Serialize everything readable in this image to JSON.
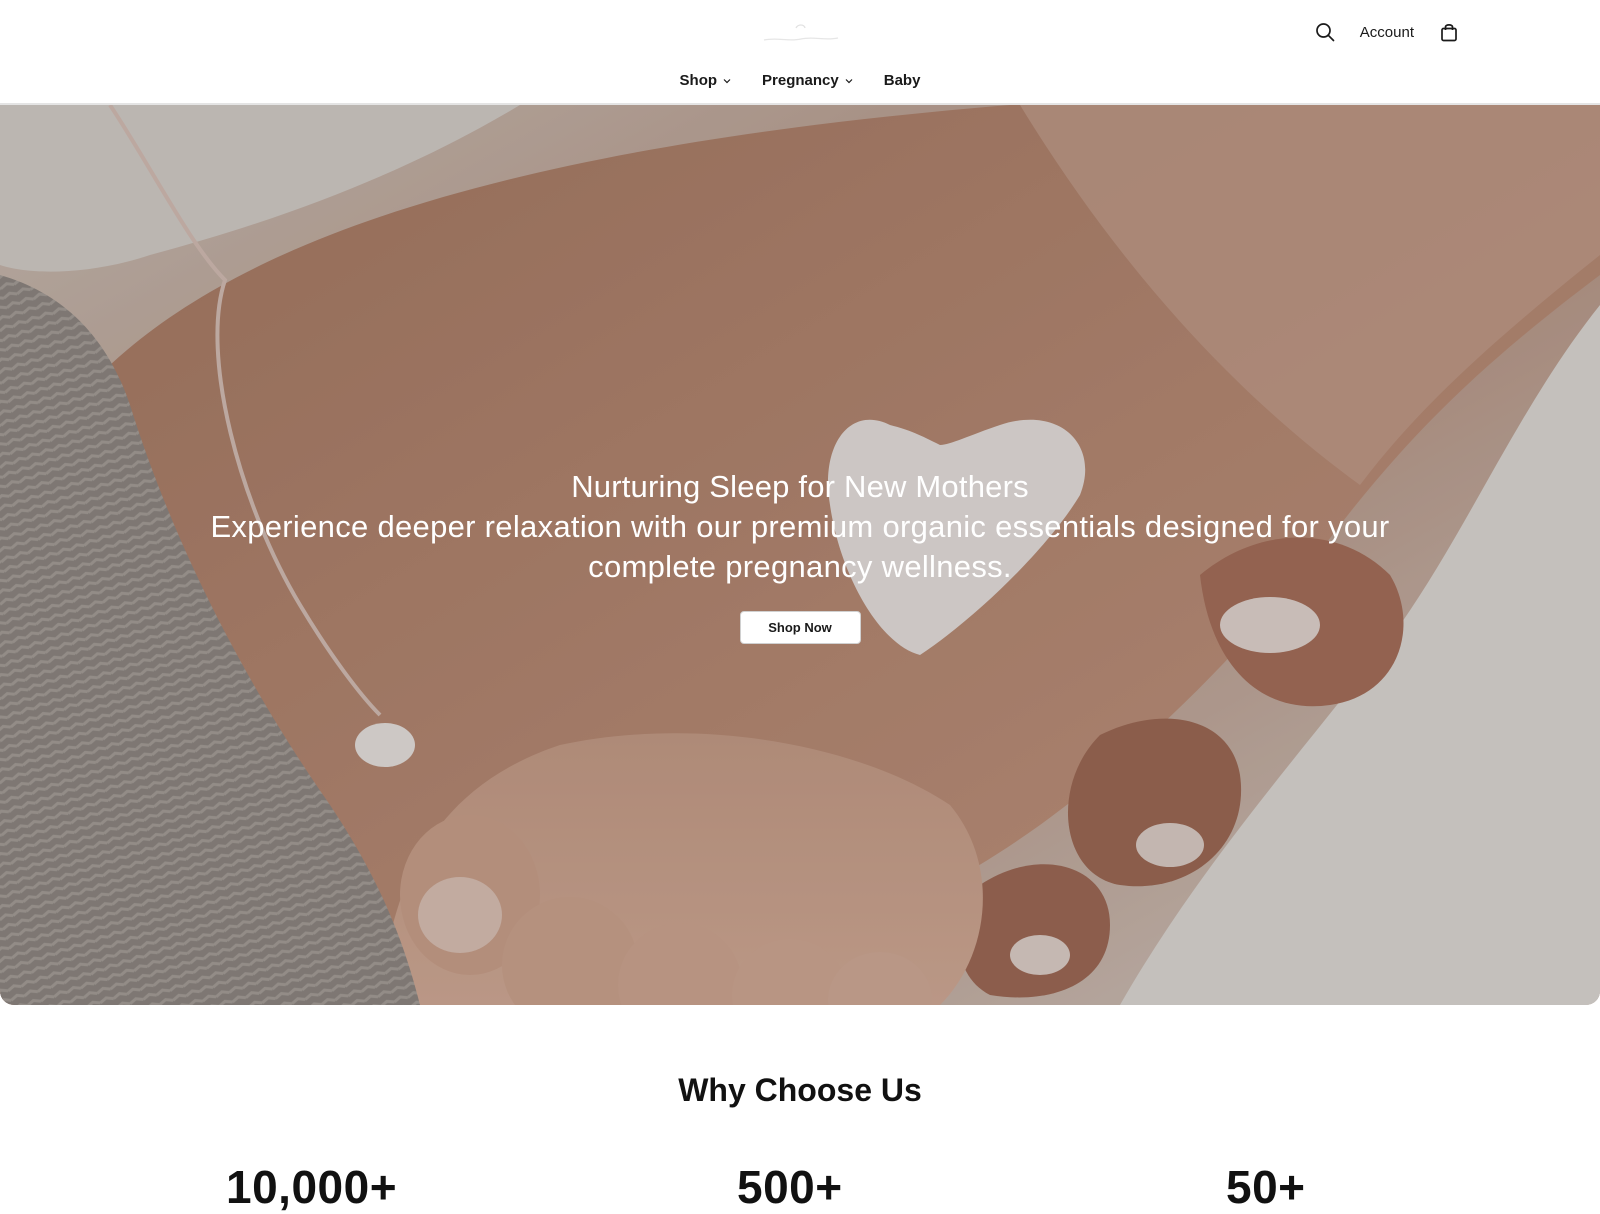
{
  "header": {
    "logo_icon": "brand-logo-icon",
    "search_icon": "search-icon",
    "account_label": "Account",
    "cart_icon": "shopping-bag-icon"
  },
  "nav": {
    "items": [
      {
        "label": "Shop",
        "has_dropdown": true
      },
      {
        "label": "Pregnancy",
        "has_dropdown": true
      },
      {
        "label": "Baby",
        "has_dropdown": false
      }
    ]
  },
  "hero": {
    "title": "Nurturing Sleep for New Mothers",
    "subtitle": "Experience deeper relaxation with our premium organic essentials designed for your complete pregnancy wellness.",
    "button_label": "Shop Now"
  },
  "why": {
    "title": "Why Choose Us",
    "stats": [
      "10,000+",
      "500+",
      "50+"
    ]
  },
  "colors": {
    "text": "#111111",
    "hero_text": "#ffffff",
    "button_bg": "#ffffff",
    "border": "#e4e4e4"
  }
}
